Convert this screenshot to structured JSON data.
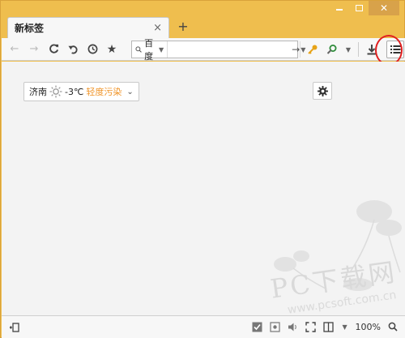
{
  "tab": {
    "title": "新标签",
    "close": "×"
  },
  "new_tab": "+",
  "toolbar": {
    "search_engine": "百度",
    "address_value": "",
    "address_placeholder": "",
    "go_arrow": "→"
  },
  "weather": {
    "city": "济南",
    "temperature": "-3℃",
    "air_quality": "轻度污染"
  },
  "statusbar": {
    "zoom": "100%"
  },
  "watermark": {
    "main": "PC下载网",
    "url": "www.pcsoft.com.cn"
  },
  "colors": {
    "frame": "#efbe4e",
    "content_bg": "#f3f3f3",
    "highlight_circle": "#e02020",
    "air_quality": "#f0952a"
  }
}
